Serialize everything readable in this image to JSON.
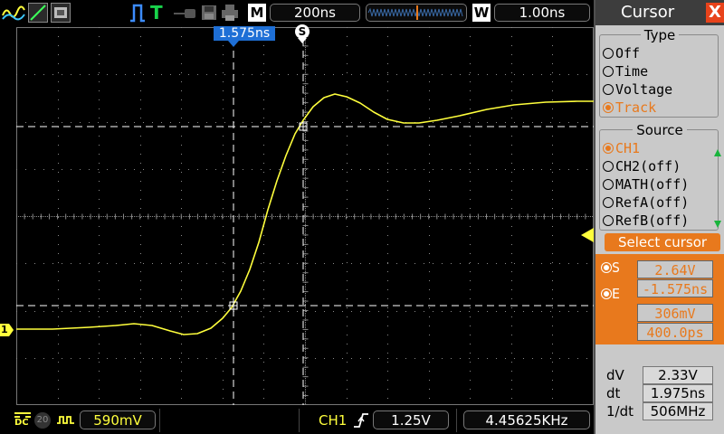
{
  "topbar": {
    "timebase_indicator": "M",
    "timebase": "200ns",
    "trigger_pos_indicator": "W",
    "delay": "1.00ns",
    "run_state_letter": "T"
  },
  "screen": {
    "cursor_time_label": "1.575ns",
    "trigger_marker_label": "S",
    "channel_marker": "1",
    "trace_color": "#ffff3c"
  },
  "bottombar": {
    "ch_scale": "590mV",
    "trigger_source": "CH1",
    "trigger_level": "1.25V",
    "frequency": "4.45625KHz",
    "dc_label": "DC",
    "bw_label": "20"
  },
  "panel": {
    "title": "Cursor",
    "close_symbol": "X",
    "type_group": {
      "title": "Type",
      "options": [
        "Off",
        "Time",
        "Voltage",
        "Track"
      ],
      "selected": "Track"
    },
    "source_group": {
      "title": "Source",
      "options": [
        "CH1",
        "CH2(off)",
        "MATH(off)",
        "RefA(off)",
        "RefB(off)"
      ],
      "selected": "CH1"
    },
    "select_cursor": {
      "title": "Select cursor",
      "s_label": "S",
      "s_voltage": "2.64V",
      "s_time": "-1.575ns",
      "e_label": "E",
      "e_voltage": "306mV",
      "e_time": "400.0ps"
    },
    "measurements": [
      {
        "label": "dV",
        "value": "2.33V"
      },
      {
        "label": "dt",
        "value": "1.975ns"
      },
      {
        "label": "1/dt",
        "value": "506MHz"
      }
    ]
  },
  "colors": {
    "accent": "#e8791d",
    "trace": "#ffff3c",
    "grid": "#8a8a8a",
    "header_blue": "#1e6fd6",
    "run_green": "#19d24b"
  }
}
